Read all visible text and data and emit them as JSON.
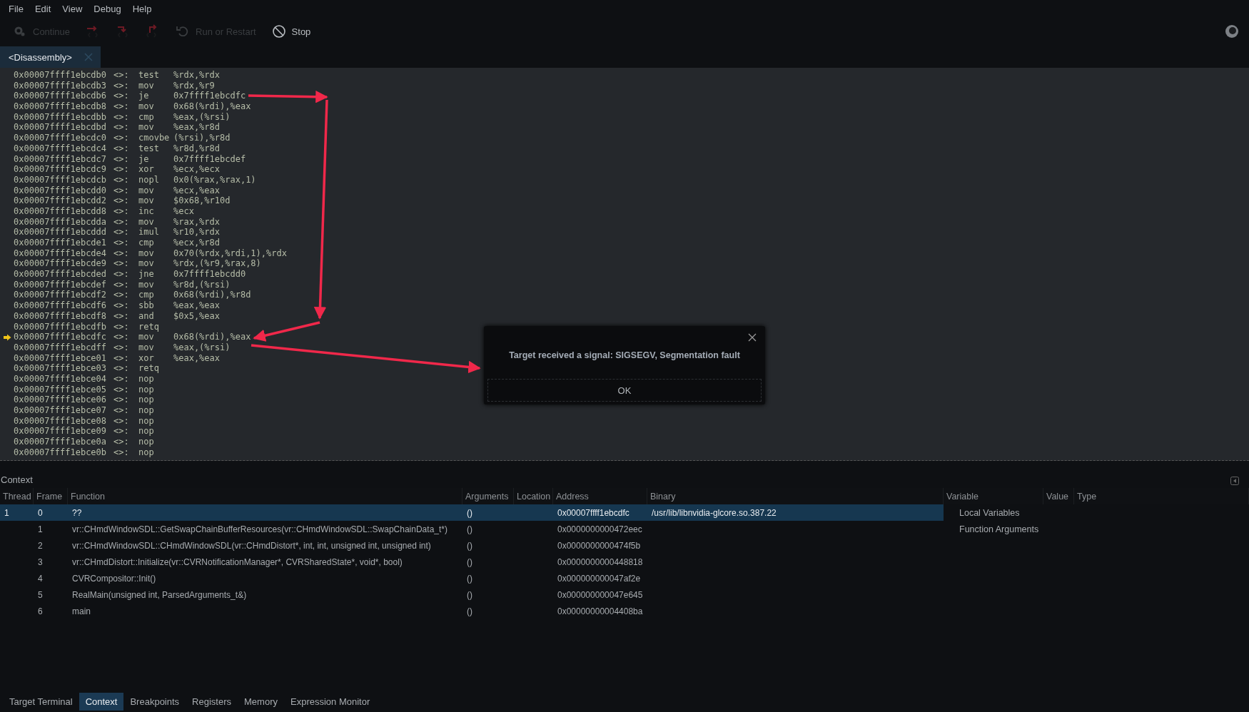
{
  "menu": [
    "File",
    "Edit",
    "View",
    "Debug",
    "Help"
  ],
  "toolbar": [
    {
      "kind": "gear",
      "label": "Continue",
      "disabled": true
    },
    {
      "kind": "step-over",
      "disabled": true
    },
    {
      "kind": "step-into",
      "disabled": true
    },
    {
      "kind": "step-out",
      "disabled": true
    },
    {
      "kind": "restart",
      "label": "Run or Restart",
      "disabled": true
    },
    {
      "kind": "stop",
      "label": "Stop",
      "disabled": false
    }
  ],
  "editor_tabs": [
    {
      "label": "<Disassembly>",
      "selected": true
    }
  ],
  "disassembly": [
    {
      "address": "0x00007ffff1ebcdb0",
      "sep": "<>:",
      "op": "test",
      "args": "%rdx,%rdx",
      "current": false
    },
    {
      "address": "0x00007ffff1ebcdb3",
      "sep": "<>:",
      "op": "mov",
      "args": "%rdx,%r9",
      "current": false
    },
    {
      "address": "0x00007ffff1ebcdb6",
      "sep": "<>:",
      "op": "je",
      "args": "0x7ffff1ebcdfc",
      "current": false
    },
    {
      "address": "0x00007ffff1ebcdb8",
      "sep": "<>:",
      "op": "mov",
      "args": "0x68(%rdi),%eax",
      "current": false
    },
    {
      "address": "0x00007ffff1ebcdbb",
      "sep": "<>:",
      "op": "cmp",
      "args": "%eax,(%rsi)",
      "current": false
    },
    {
      "address": "0x00007ffff1ebcdbd",
      "sep": "<>:",
      "op": "mov",
      "args": "%eax,%r8d",
      "current": false
    },
    {
      "address": "0x00007ffff1ebcdc0",
      "sep": "<>:",
      "op": "cmovbe",
      "args": "(%rsi),%r8d",
      "current": false
    },
    {
      "address": "0x00007ffff1ebcdc4",
      "sep": "<>:",
      "op": "test",
      "args": "%r8d,%r8d",
      "current": false
    },
    {
      "address": "0x00007ffff1ebcdc7",
      "sep": "<>:",
      "op": "je",
      "args": "0x7ffff1ebcdef",
      "current": false
    },
    {
      "address": "0x00007ffff1ebcdc9",
      "sep": "<>:",
      "op": "xor",
      "args": "%ecx,%ecx",
      "current": false
    },
    {
      "address": "0x00007ffff1ebcdcb",
      "sep": "<>:",
      "op": "nopl",
      "args": "0x0(%rax,%rax,1)",
      "current": false
    },
    {
      "address": "0x00007ffff1ebcdd0",
      "sep": "<>:",
      "op": "mov",
      "args": "%ecx,%eax",
      "current": false
    },
    {
      "address": "0x00007ffff1ebcdd2",
      "sep": "<>:",
      "op": "mov",
      "args": "$0x68,%r10d",
      "current": false
    },
    {
      "address": "0x00007ffff1ebcdd8",
      "sep": "<>:",
      "op": "inc",
      "args": "%ecx",
      "current": false
    },
    {
      "address": "0x00007ffff1ebcdda",
      "sep": "<>:",
      "op": "mov",
      "args": "%rax,%rdx",
      "current": false
    },
    {
      "address": "0x00007ffff1ebcddd",
      "sep": "<>:",
      "op": "imul",
      "args": "%r10,%rdx",
      "current": false
    },
    {
      "address": "0x00007ffff1ebcde1",
      "sep": "<>:",
      "op": "cmp",
      "args": "%ecx,%r8d",
      "current": false
    },
    {
      "address": "0x00007ffff1ebcde4",
      "sep": "<>:",
      "op": "mov",
      "args": "0x70(%rdx,%rdi,1),%rdx",
      "current": false
    },
    {
      "address": "0x00007ffff1ebcde9",
      "sep": "<>:",
      "op": "mov",
      "args": "%rdx,(%r9,%rax,8)",
      "current": false
    },
    {
      "address": "0x00007ffff1ebcded",
      "sep": "<>:",
      "op": "jne",
      "args": "0x7ffff1ebcdd0",
      "current": false
    },
    {
      "address": "0x00007ffff1ebcdef",
      "sep": "<>:",
      "op": "mov",
      "args": "%r8d,(%rsi)",
      "current": false
    },
    {
      "address": "0x00007ffff1ebcdf2",
      "sep": "<>:",
      "op": "cmp",
      "args": "0x68(%rdi),%r8d",
      "current": false
    },
    {
      "address": "0x00007ffff1ebcdf6",
      "sep": "<>:",
      "op": "sbb",
      "args": "%eax,%eax",
      "current": false
    },
    {
      "address": "0x00007ffff1ebcdf8",
      "sep": "<>:",
      "op": "and",
      "args": "$0x5,%eax",
      "current": false
    },
    {
      "address": "0x00007ffff1ebcdfb",
      "sep": "<>:",
      "op": "retq",
      "current": false
    },
    {
      "address": "0x00007ffff1ebcdfc",
      "sep": "<>:",
      "op": "mov",
      "args": "0x68(%rdi),%eax",
      "current": true
    },
    {
      "address": "0x00007ffff1ebcdff",
      "sep": "<>:",
      "op": "mov",
      "args": "%eax,(%rsi)",
      "current": false
    },
    {
      "address": "0x00007ffff1ebce01",
      "sep": "<>:",
      "op": "xor",
      "args": "%eax,%eax",
      "current": false
    },
    {
      "address": "0x00007ffff1ebce03",
      "sep": "<>:",
      "op": "retq",
      "current": false
    },
    {
      "address": "0x00007ffff1ebce04",
      "sep": "<>:",
      "op": "nop",
      "current": false
    },
    {
      "address": "0x00007ffff1ebce05",
      "sep": "<>:",
      "op": "nop",
      "current": false
    },
    {
      "address": "0x00007ffff1ebce06",
      "sep": "<>:",
      "op": "nop",
      "current": false
    },
    {
      "address": "0x00007ffff1ebce07",
      "sep": "<>:",
      "op": "nop",
      "current": false
    },
    {
      "address": "0x00007ffff1ebce08",
      "sep": "<>:",
      "op": "nop",
      "current": false
    },
    {
      "address": "0x00007ffff1ebce09",
      "sep": "<>:",
      "op": "nop",
      "current": false
    },
    {
      "address": "0x00007ffff1ebce0a",
      "sep": "<>:",
      "op": "nop",
      "current": false
    },
    {
      "address": "0x00007ffff1ebce0b",
      "sep": "<>:",
      "op": "nop",
      "current": false
    }
  ],
  "dialog": {
    "message": "Target received a signal: SIGSEGV, Segmentation fault",
    "button": "OK"
  },
  "context": {
    "title": "Context",
    "columns": [
      "Thread",
      "Frame",
      "Function",
      "Arguments",
      "Location",
      "Address",
      "Binary"
    ],
    "rows": [
      {
        "thread": "1",
        "frame": "0",
        "function": "??",
        "arguments": "()",
        "address": "0x00007ffff1ebcdfc",
        "binary": "/usr/lib/libnvidia-glcore.so.387.22",
        "selected": true
      },
      {
        "frame": "1",
        "function": "vr::CHmdWindowSDL::GetSwapChainBufferResources(vr::CHmdWindowSDL::SwapChainData_t*)",
        "arguments": "()",
        "address": "0x0000000000472eec",
        "selected": false
      },
      {
        "frame": "2",
        "function": "vr::CHmdWindowSDL::CHmdWindowSDL(vr::CHmdDistort*, int, int, unsigned int, unsigned int)",
        "arguments": "()",
        "address": "0x0000000000474f5b",
        "selected": false
      },
      {
        "frame": "3",
        "function": "vr::CHmdDistort::Initialize(vr::CVRNotificationManager*, CVRSharedState*, void*, bool)",
        "arguments": "()",
        "address": "0x0000000000448818",
        "selected": false
      },
      {
        "frame": "4",
        "function": "CVRCompositor::Init()",
        "arguments": "()",
        "address": "0x000000000047af2e",
        "selected": false
      },
      {
        "frame": "5",
        "function": "RealMain(unsigned int, ParsedArguments_t&)",
        "arguments": "()",
        "address": "0x000000000047e645",
        "selected": false
      },
      {
        "frame": "6",
        "function": "main",
        "arguments": "()",
        "address": "0x00000000004408ba",
        "selected": false
      }
    ],
    "variable_columns": [
      "Variable",
      "Value",
      "Type"
    ],
    "variables": [
      "Local Variables",
      "Function Arguments"
    ]
  },
  "bottom_tabs": [
    {
      "label": "Target Terminal",
      "selected": false
    },
    {
      "label": "Context",
      "selected": true
    },
    {
      "label": "Breakpoints",
      "selected": false
    },
    {
      "label": "Registers",
      "selected": false
    },
    {
      "label": "Memory",
      "selected": false
    },
    {
      "label": "Expression Monitor",
      "selected": false
    }
  ]
}
